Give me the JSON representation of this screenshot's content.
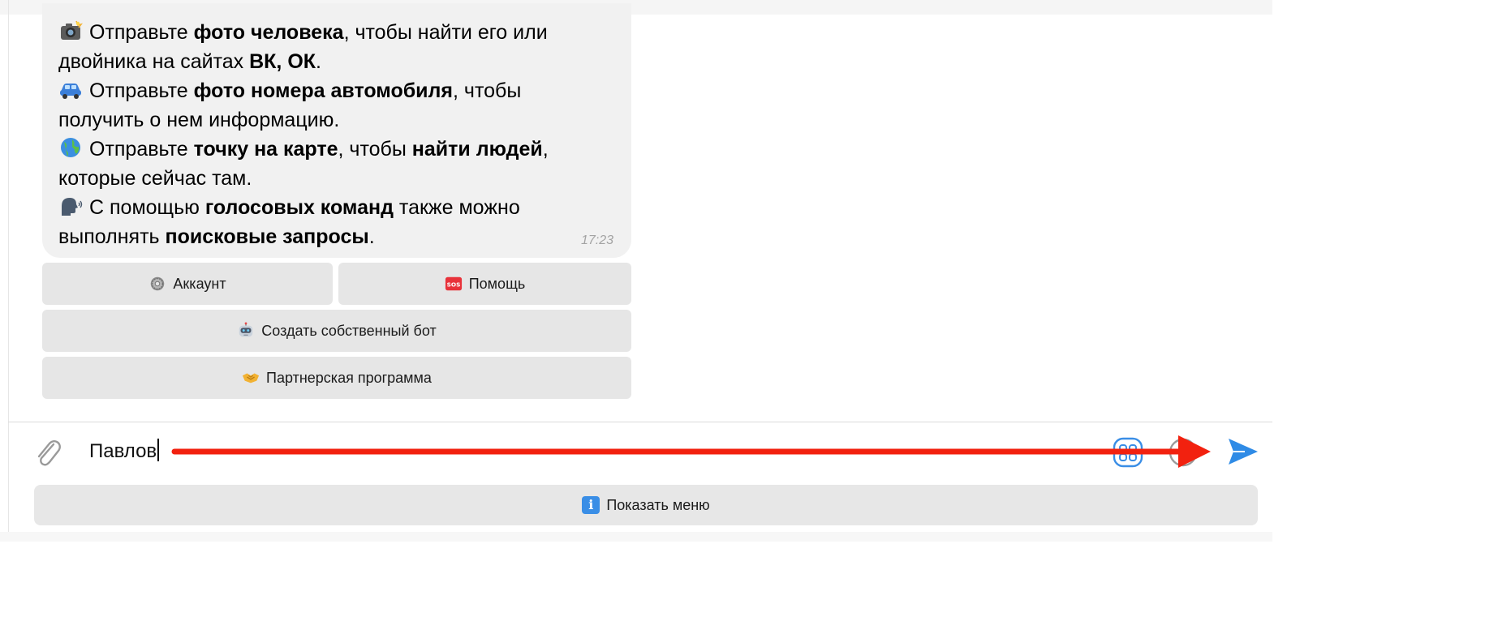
{
  "message": {
    "lines": [
      [
        {
          "t": "Отправьте ",
          "b": false
        },
        {
          "t": "фото человека",
          "b": true
        },
        {
          "t": ", чтобы найти его или",
          "b": false
        }
      ],
      [
        {
          "t": "двойника на сайтах ",
          "b": false
        },
        {
          "t": "ВК, ОК",
          "b": true
        },
        {
          "t": ".",
          "b": false
        }
      ],
      [
        {
          "t": "Отправьте ",
          "b": false
        },
        {
          "t": "фото номера автомобиля",
          "b": true
        },
        {
          "t": ", чтобы",
          "b": false
        }
      ],
      [
        {
          "t": "получить о нем информацию.",
          "b": false
        }
      ],
      [
        {
          "t": "Отправьте ",
          "b": false
        },
        {
          "t": "точку на карте",
          "b": true
        },
        {
          "t": ", чтобы ",
          "b": false
        },
        {
          "t": "найти людей",
          "b": true
        },
        {
          "t": ",",
          "b": false
        }
      ],
      [
        {
          "t": "которые сейчас там.",
          "b": false
        }
      ],
      [
        {
          "t": "С помощью ",
          "b": false
        },
        {
          "t": "голосовых команд",
          "b": true
        },
        {
          "t": " также можно",
          "b": false
        }
      ],
      [
        {
          "t": "выполнять ",
          "b": false
        },
        {
          "t": "поисковые запросы",
          "b": true
        },
        {
          "t": ".",
          "b": false
        }
      ]
    ],
    "line_icons": [
      "camera-flash-icon",
      "",
      "car-icon",
      "",
      "globe-icon",
      "",
      "speaking-head-icon",
      ""
    ],
    "time": "17:23"
  },
  "keyboard": {
    "account_label": "Аккаунт",
    "help_label": "Помощь",
    "create_bot_label": "Создать собственный бот",
    "partner_label": "Партнерская программа"
  },
  "composer": {
    "input_value": "Павлов"
  },
  "menu_button": {
    "label": "Показать меню",
    "icon_glyph": "i"
  },
  "colors": {
    "send": "#2f8be6",
    "annotation_arrow": "#f2210f",
    "bubble": "#f1f1f1",
    "button": "#e6e6e6"
  }
}
